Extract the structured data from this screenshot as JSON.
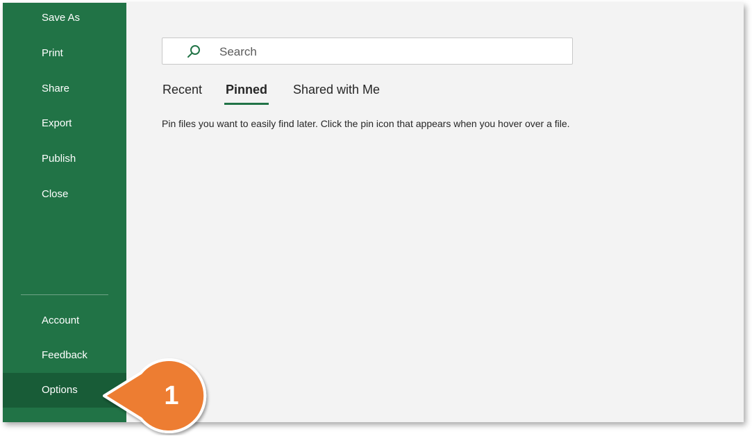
{
  "sidebar": {
    "items": [
      {
        "label": "Save As"
      },
      {
        "label": "Print"
      },
      {
        "label": "Share"
      },
      {
        "label": "Export"
      },
      {
        "label": "Publish"
      },
      {
        "label": "Close"
      }
    ],
    "bottom_items": [
      {
        "label": "Account"
      },
      {
        "label": "Feedback"
      },
      {
        "label": "Options",
        "active": true
      }
    ]
  },
  "search": {
    "placeholder": "Search",
    "icon": "search-icon"
  },
  "tabs": [
    {
      "label": "Recent",
      "active": false
    },
    {
      "label": "Pinned",
      "active": true
    },
    {
      "label": "Shared with Me",
      "active": false
    }
  ],
  "pinned_hint": "Pin files you want to easily find later. Click the pin icon that appears when you hover over a file.",
  "callout": {
    "number": "1",
    "color": "#ed7d31"
  },
  "colors": {
    "sidebar": "#217346",
    "sidebar_active": "#185c37",
    "accent": "#217346",
    "background": "#f3f3f3"
  }
}
